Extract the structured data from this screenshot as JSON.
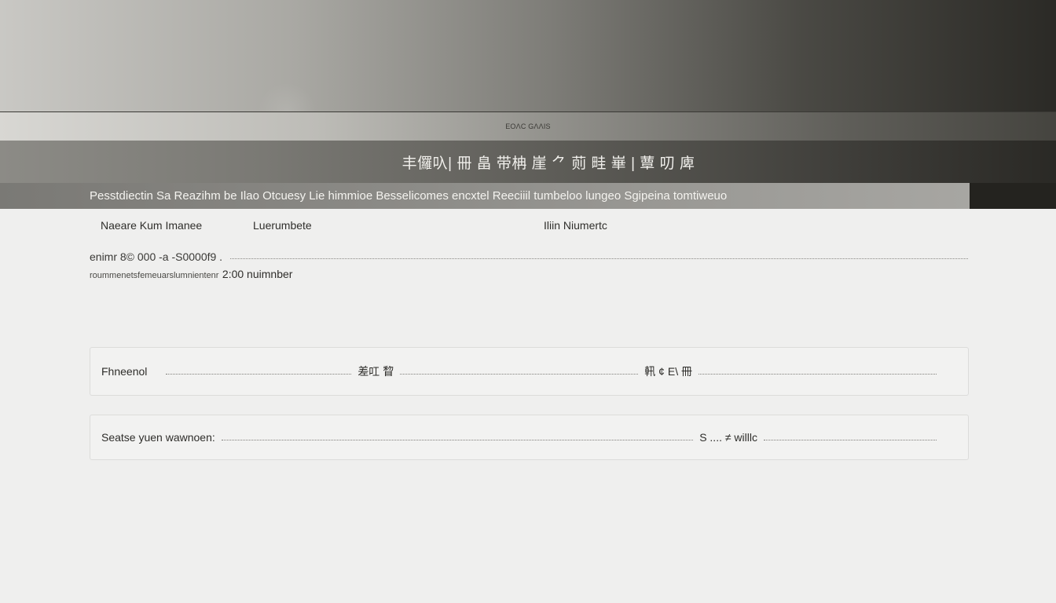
{
  "header": {
    "subtitle": "ЕОΛС GΛΛIS",
    "title": "丰儸叺| 冊 畠 带柟 崖 ⺈ 荝 畦 崋 | 蕈 叨 庳",
    "description": "Pesstdiectin Sa Reazihm be Ilao Otcuesy Lie himmioe Besselicomes encxtel Reeciiil tumbeloo lungeo Sgipeina tomtiweuo"
  },
  "fields": {
    "label_1": "Naeare Kum Imanee",
    "label_2": "Luerumbete",
    "label_3": "Iliin Niumertc"
  },
  "info": {
    "range_text": "enimr 8© 000 -a -S0000f9 .",
    "sub_small": "roummenetsfemeuarslumnientenr",
    "sub_value": "2:00 nuimnber"
  },
  "card1": {
    "label": "Fhneenol",
    "mid_label": "差叿 睝",
    "right_label": "軐 ¢ E\\ 冊"
  },
  "card2": {
    "label": "Seatse yuen wawnoen:",
    "mid_label": "S .... ≠ willlc"
  }
}
